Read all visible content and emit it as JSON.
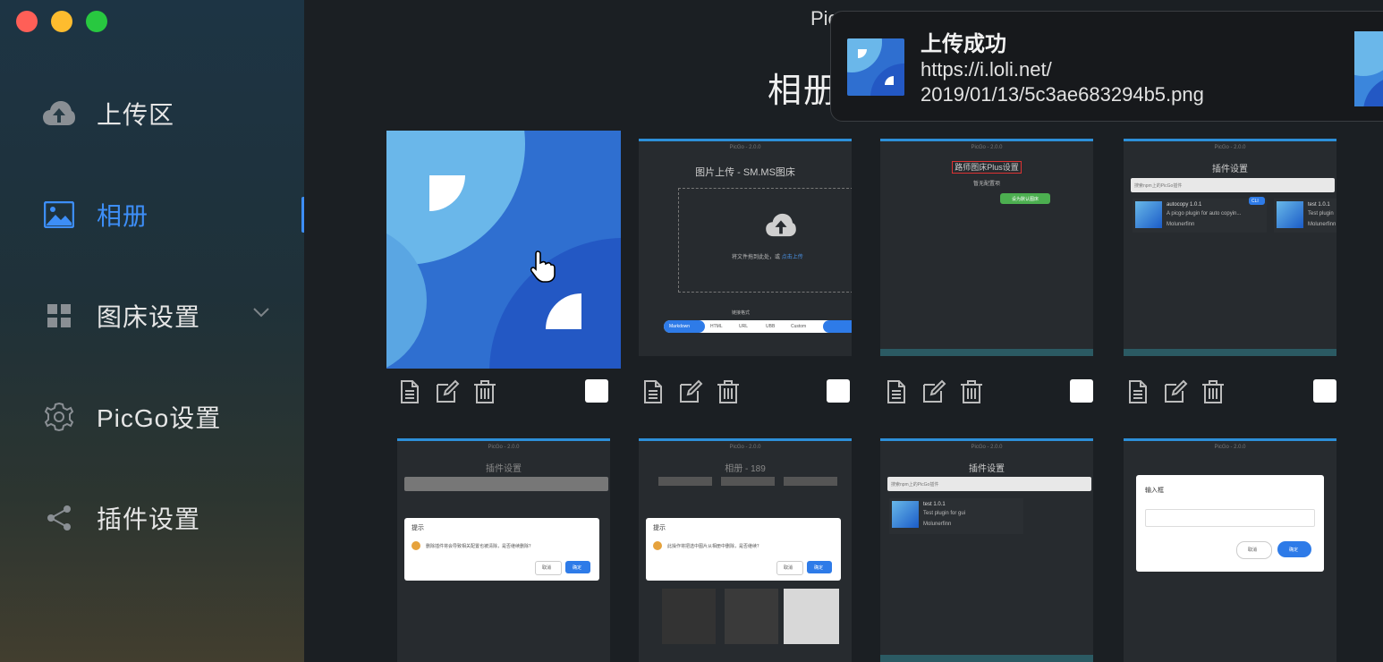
{
  "window": {
    "title": "PicGo"
  },
  "sidebar": {
    "items": [
      {
        "label": "上传区",
        "icon": "cloud-upload-icon"
      },
      {
        "label": "相册",
        "icon": "image-icon",
        "active": true
      },
      {
        "label": "图床设置",
        "icon": "grid-icon",
        "expandable": true
      },
      {
        "label": "PicGo设置",
        "icon": "gear-icon"
      },
      {
        "label": "插件设置",
        "icon": "share-icon"
      }
    ]
  },
  "main": {
    "title": "相册"
  },
  "thumbs": {
    "t2": {
      "title": "PicGo - 2.0.0",
      "heading": "图片上传 - SM.MS图床",
      "drop_text": "将文件拖到此处，或",
      "drop_link": "点击上传",
      "link_format": "链接格式",
      "formats": [
        "Markdown",
        "HTML",
        "URL",
        "UBB",
        "Custom"
      ]
    },
    "t3": {
      "title": "PicGo - 2.0.0",
      "heading": "路师图床Plus设置",
      "sub": "暂无配置项",
      "btn": "设为默认图床"
    },
    "t4": {
      "title": "PicGo - 2.0.0",
      "heading": "插件设置",
      "search": "搜索npm上的PicGo插件",
      "p1_name": "autocopy 1.0.1",
      "p1_desc": "A picgo plugin for auto copyin...",
      "p1_author": "Molunerfinn",
      "p2_name": "test 1.0.1",
      "p2_desc": "Test plugin",
      "p2_author": "Molunerfinn",
      "tag": "CLI"
    },
    "t5": {
      "title": "PicGo - 2.0.0",
      "heading": "插件设置",
      "dlg_title": "提示",
      "dlg_text": "删除插件将会导致相关配置也被清除，是否继续删除？",
      "cancel": "取消",
      "ok": "确定"
    },
    "t6": {
      "title": "PicGo - 2.0.0",
      "heading": "相册 - 189",
      "dlg_title": "提示",
      "dlg_text": "此操作将把选中图片从相册中删除，是否继续？",
      "cancel": "取消",
      "ok": "确定"
    },
    "t7": {
      "title": "PicGo - 2.0.0",
      "heading": "插件设置",
      "search": "搜索npm上的PicGo插件",
      "p_name": "test 1.0.1",
      "p_desc": "Test plugin for gui",
      "p_author": "Molunerfinn"
    },
    "t8": {
      "title": "PicGo - 2.0.0",
      "dlg_title": "输入框",
      "cancel": "取消",
      "ok": "确定"
    }
  },
  "notification": {
    "title": "上传成功",
    "line1": "https://i.loli.net/",
    "line2": "2019/01/13/5c3ae683294b5.png"
  },
  "colors": {
    "accent": "#3d8ef7",
    "thumb_border": "#2d8fd8"
  }
}
